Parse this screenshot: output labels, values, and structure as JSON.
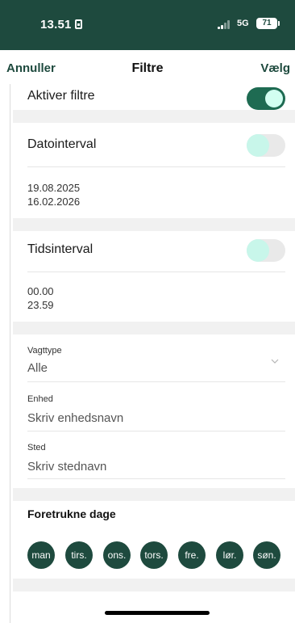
{
  "status_bar": {
    "time": "13.51",
    "network": "5G",
    "battery": "71"
  },
  "nav": {
    "cancel": "Annuller",
    "title": "Filtre",
    "select": "Vælg"
  },
  "enable_filters": {
    "label": "Aktiver filtre",
    "enabled": true
  },
  "date_interval": {
    "label": "Datointerval",
    "enabled": false,
    "from": "19.08.2025",
    "to": "16.02.2026"
  },
  "time_interval": {
    "label": "Tidsinterval",
    "enabled": false,
    "from": "00.00",
    "to": "23.59"
  },
  "shift_type": {
    "label": "Vagttype",
    "value": "Alle"
  },
  "unit": {
    "label": "Enhed",
    "placeholder": "Skriv enhedsnavn"
  },
  "place": {
    "label": "Sted",
    "placeholder": "Skriv stednavn"
  },
  "preferred_days": {
    "title": "Foretrukne dage",
    "days": [
      "man",
      "tirs.",
      "ons.",
      "tors.",
      "fre.",
      "lør.",
      "søn."
    ]
  },
  "colors": {
    "brand": "#1e4a3e",
    "toggle_on": "#1e6b52",
    "toggle_knob": "#c8f6ea"
  }
}
